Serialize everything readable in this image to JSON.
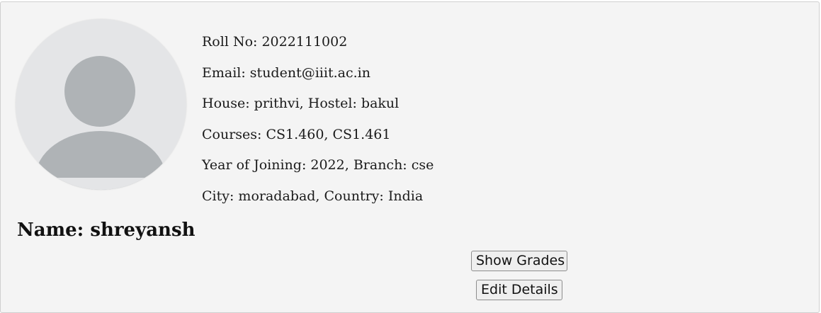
{
  "profile": {
    "roll_no": "Roll No: 2022111002",
    "email": "Email: student@iiit.ac.in",
    "house_hostel": "House: prithvi, Hostel: bakul",
    "courses": "Courses: CS1.460, CS1.461",
    "year_branch": "Year of Joining: 2022, Branch: cse",
    "city_country": "City: moradabad, Country: India",
    "name": "Name: shreyansh"
  },
  "actions": {
    "show_grades_label": "Show Grades",
    "edit_details_label": "Edit Details"
  },
  "icons": {
    "avatar": "default-user-avatar-icon"
  },
  "colors": {
    "card_background": "#f4f4f4",
    "avatar_background": "#e4e5e7",
    "avatar_silhouette": "#afb3b6"
  }
}
